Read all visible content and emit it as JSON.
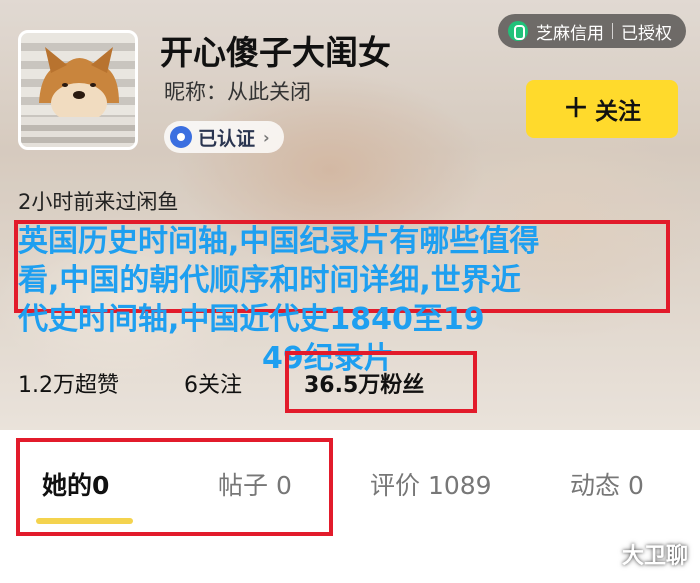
{
  "header": {
    "zhima_label": "芝麻信用",
    "zhima_status": "已授权"
  },
  "profile": {
    "username": "开心傻子大闺女",
    "nickname": "昵称：从此关闭",
    "verified_label": "已认证",
    "verified_chevron": "›",
    "follow_plus": "＋",
    "follow_label": "关注",
    "last_seen": "2小时前来过闲鱼",
    "bio_lines": [
      "英国历史时间轴,中国纪录片有哪些值得",
      "看,中国的朝代顺序和时间详细,世界近",
      "代史时间轴,中国近代史1840至19",
      "49纪录片"
    ]
  },
  "stats": {
    "likes": "1.2万超赞",
    "following": "6关注",
    "fans": "36.5万粉丝"
  },
  "tabs": [
    {
      "label": "她的0"
    },
    {
      "label": "帖子 0"
    },
    {
      "label": "评价 1089"
    },
    {
      "label": "动态 0"
    }
  ],
  "watermark": "大卫聊",
  "colors": {
    "accent_yellow": "#ffda2c",
    "highlight_red": "#e21b2b",
    "overlay_blue": "#1e9ff0",
    "zhima_green": "#21c27a"
  }
}
